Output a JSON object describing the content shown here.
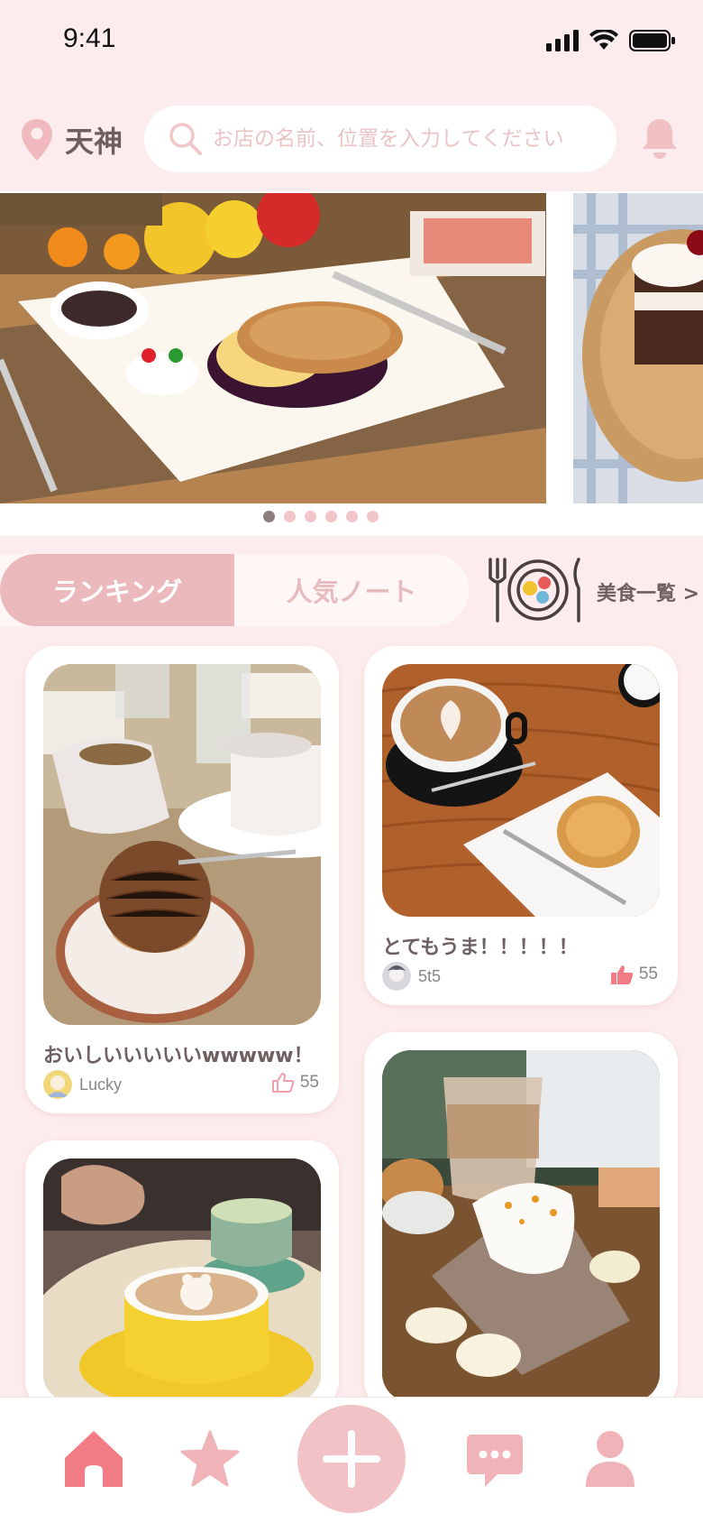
{
  "status_bar": {
    "time": "9:41"
  },
  "header": {
    "location": "天神",
    "search_placeholder": "お店の名前、位置を入力してください"
  },
  "carousel": {
    "slide_count": 6,
    "active_index": 0
  },
  "tabs": {
    "ranking": "ランキング",
    "popular_notes": "人気ノート",
    "food_list_link": "美食一覧 >"
  },
  "posts": [
    {
      "title": "おいしいいいいいwwwww！",
      "user": "Lucky",
      "likes": "55",
      "liked": false
    },
    {
      "title": "とてもうま！！！！！",
      "user": "5t5",
      "likes": "55",
      "liked": true
    },
    {
      "title": "",
      "user": "",
      "likes": ""
    },
    {
      "title": "",
      "user": "",
      "likes": ""
    }
  ],
  "tabbar": {
    "items": [
      "home-icon",
      "star-icon",
      "add-icon",
      "chat-icon",
      "profile-icon"
    ],
    "active": "home-icon"
  },
  "colors": {
    "background": "#fdeced",
    "accent": "#ebb8bc",
    "accent_strong": "#f27c86",
    "add_button": "#f2c3c6",
    "like_active": "#f27c86"
  }
}
